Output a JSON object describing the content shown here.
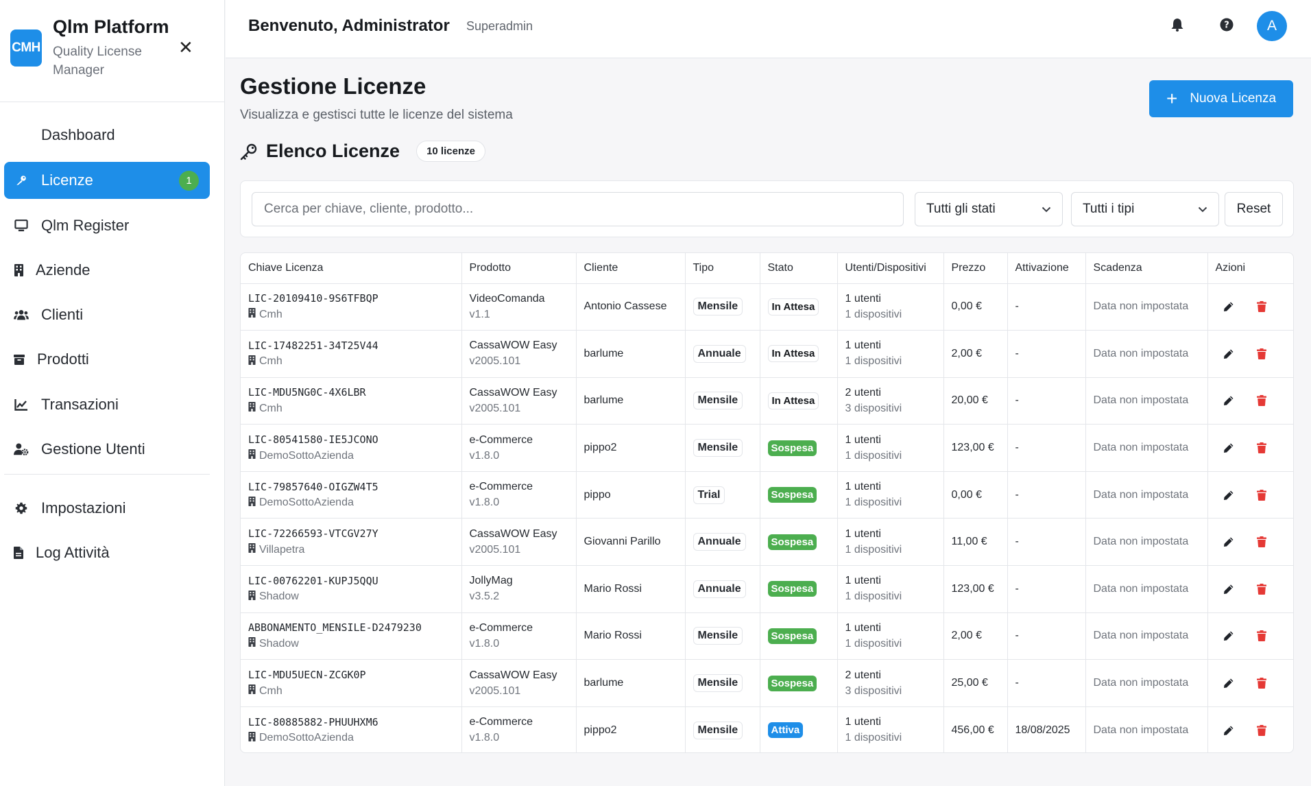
{
  "brand": {
    "logo_text": "CMH",
    "title": "Qlm Platform",
    "subtitle": "Quality License Manager",
    "accent": "#1e8ee8"
  },
  "sidebar": {
    "items": [
      {
        "label": "Dashboard",
        "icon": "none"
      },
      {
        "label": "Licenze",
        "icon": "key-icon",
        "badge": "1",
        "active": true
      },
      {
        "label": "Qlm Register",
        "icon": "monitor-icon"
      },
      {
        "label": "Aziende",
        "icon": "building-icon"
      },
      {
        "label": "Clienti",
        "icon": "users-icon"
      },
      {
        "label": "Prodotti",
        "icon": "box-icon"
      },
      {
        "label": "Transazioni",
        "icon": "chart-line-icon"
      },
      {
        "label": "Gestione Utenti",
        "icon": "user-cog-icon"
      },
      {
        "label": "Impostazioni",
        "icon": "gear-icon"
      },
      {
        "label": "Log Attività",
        "icon": "file-icon"
      }
    ]
  },
  "topbar": {
    "welcome": "Benvenuto, Administrator",
    "role": "Superadmin",
    "avatar_letter": "A"
  },
  "page": {
    "title": "Gestione Licenze",
    "subtitle": "Visualizza e gestisci tutte le licenze del sistema",
    "new_button": "Nuova Licenza",
    "list_title": "Elenco Licenze",
    "count_label": "10 licenze"
  },
  "filters": {
    "search_placeholder": "Cerca per chiave, cliente, prodotto...",
    "status_selected": "Tutti gli stati",
    "type_selected": "Tutti i tipi",
    "reset_label": "Reset"
  },
  "table": {
    "columns": [
      "Chiave Licenza",
      "Prodotto",
      "Cliente",
      "Tipo",
      "Stato",
      "Utenti/Dispositivi",
      "Prezzo",
      "Attivazione",
      "Scadenza",
      "Azioni"
    ],
    "rows": [
      {
        "key": "LIC-20109410-9S6TFBQP",
        "company": "Cmh",
        "product": "VideoComanda",
        "version": "v1.1",
        "client": "Antonio Cassese",
        "type": "Mensile",
        "status": "In Attesa",
        "status_kind": "attesa",
        "users": "1 utenti",
        "devices": "1 dispositivi",
        "price": "0,00 €",
        "activation": "-",
        "expiry": "Data non impostata"
      },
      {
        "key": "LIC-17482251-34T25V44",
        "company": "Cmh",
        "product": "CassaWOW Easy",
        "version": "v2005.101",
        "client": "barlume",
        "type": "Annuale",
        "status": "In Attesa",
        "status_kind": "attesa",
        "users": "1 utenti",
        "devices": "1 dispositivi",
        "price": "2,00 €",
        "activation": "-",
        "expiry": "Data non impostata"
      },
      {
        "key": "LIC-MDU5NG0C-4X6LBR",
        "company": "Cmh",
        "product": "CassaWOW Easy",
        "version": "v2005.101",
        "client": "barlume",
        "type": "Mensile",
        "status": "In Attesa",
        "status_kind": "attesa",
        "users": "2 utenti",
        "devices": "3 dispositivi",
        "price": "20,00 €",
        "activation": "-",
        "expiry": "Data non impostata"
      },
      {
        "key": "LIC-80541580-IE5JCONO",
        "company": "DemoSottoAzienda",
        "product": "e-Commerce",
        "version": "v1.8.0",
        "client": "pippo2",
        "type": "Mensile",
        "status": "Sospesa",
        "status_kind": "sospesa",
        "users": "1 utenti",
        "devices": "1 dispositivi",
        "price": "123,00 €",
        "activation": "-",
        "expiry": "Data non impostata"
      },
      {
        "key": "LIC-79857640-OIGZW4T5",
        "company": "DemoSottoAzienda",
        "product": "e-Commerce",
        "version": "v1.8.0",
        "client": "pippo",
        "type": "Trial",
        "status": "Sospesa",
        "status_kind": "sospesa",
        "users": "1 utenti",
        "devices": "1 dispositivi",
        "price": "0,00 €",
        "activation": "-",
        "expiry": "Data non impostata"
      },
      {
        "key": "LIC-72266593-VTCGV27Y",
        "company": "Villapetra",
        "product": "CassaWOW Easy",
        "version": "v2005.101",
        "client": "Giovanni Parillo",
        "type": "Annuale",
        "status": "Sospesa",
        "status_kind": "sospesa",
        "users": "1 utenti",
        "devices": "1 dispositivi",
        "price": "11,00 €",
        "activation": "-",
        "expiry": "Data non impostata"
      },
      {
        "key": "LIC-00762201-KUPJ5QQU",
        "company": "Shadow",
        "product": "JollyMag",
        "version": "v3.5.2",
        "client": "Mario Rossi",
        "type": "Annuale",
        "status": "Sospesa",
        "status_kind": "sospesa",
        "users": "1 utenti",
        "devices": "1 dispositivi",
        "price": "123,00 €",
        "activation": "-",
        "expiry": "Data non impostata"
      },
      {
        "key": "ABBONAMENTO_MENSILE-D2479230",
        "company": "Shadow",
        "product": "e-Commerce",
        "version": "v1.8.0",
        "client": "Mario Rossi",
        "type": "Mensile",
        "status": "Sospesa",
        "status_kind": "sospesa",
        "users": "1 utenti",
        "devices": "1 dispositivi",
        "price": "2,00 €",
        "activation": "-",
        "expiry": "Data non impostata"
      },
      {
        "key": "LIC-MDU5UECN-ZCGK0P",
        "company": "Cmh",
        "product": "CassaWOW Easy",
        "version": "v2005.101",
        "client": "barlume",
        "type": "Mensile",
        "status": "Sospesa",
        "status_kind": "sospesa",
        "users": "2 utenti",
        "devices": "3 dispositivi",
        "price": "25,00 €",
        "activation": "-",
        "expiry": "Data non impostata"
      },
      {
        "key": "LIC-80885882-PHUUHXM6",
        "company": "DemoSottoAzienda",
        "product": "e-Commerce",
        "version": "v1.8.0",
        "client": "pippo2",
        "type": "Mensile",
        "status": "Attiva",
        "status_kind": "attiva",
        "users": "1 utenti",
        "devices": "1 dispositivi",
        "price": "456,00 €",
        "activation": "18/08/2025",
        "expiry": "Data non impostata"
      }
    ]
  },
  "colors": {
    "primary": "#1e8ee8",
    "success": "#4cae4f",
    "danger": "#e53935"
  }
}
